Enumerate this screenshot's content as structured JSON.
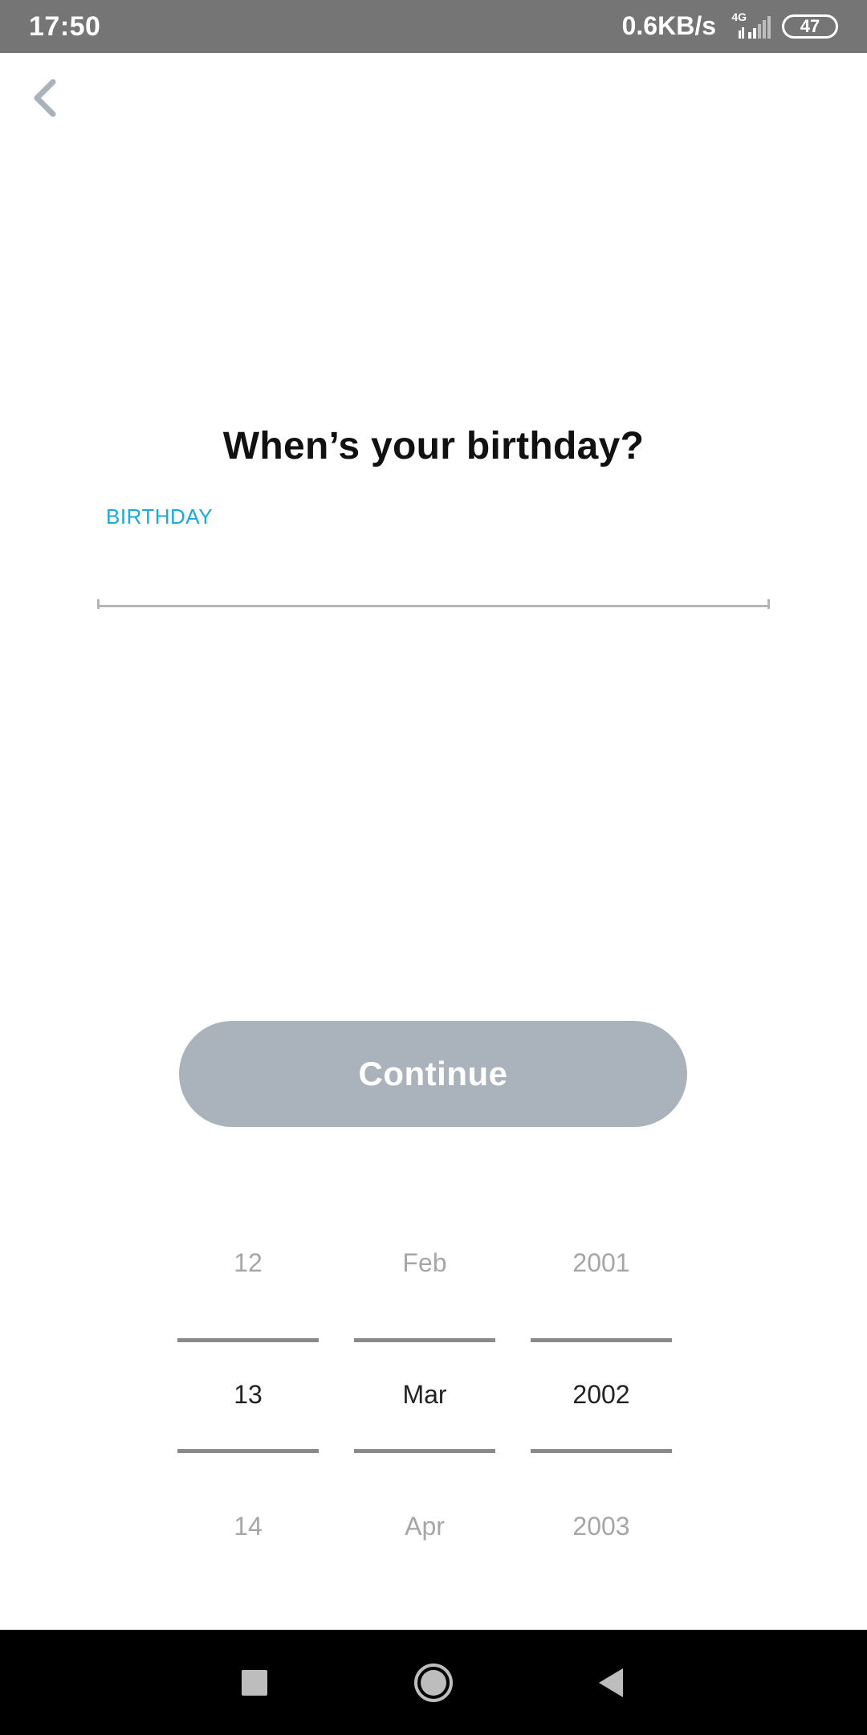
{
  "status_bar": {
    "time": "17:50",
    "speed": "0.6KB/s",
    "network": "4G",
    "battery": "47"
  },
  "screen": {
    "title": "When’s your birthday?",
    "field_label": "BIRTHDAY",
    "field_value": "",
    "continue_label": "Continue"
  },
  "picker": {
    "day": {
      "prev": "12",
      "selected": "13",
      "next": "14"
    },
    "month": {
      "prev": "Feb",
      "selected": "Mar",
      "next": "Apr"
    },
    "year": {
      "prev": "2001",
      "selected": "2002",
      "next": "2003"
    }
  },
  "colors": {
    "accent": "#1ba8dc",
    "button_disabled": "#aab3bb",
    "status_bar": "#757575"
  },
  "icons": {
    "back": "chevron-left-icon",
    "nav_recent": "square-icon",
    "nav_home": "circle-icon",
    "nav_back": "triangle-left-icon"
  }
}
